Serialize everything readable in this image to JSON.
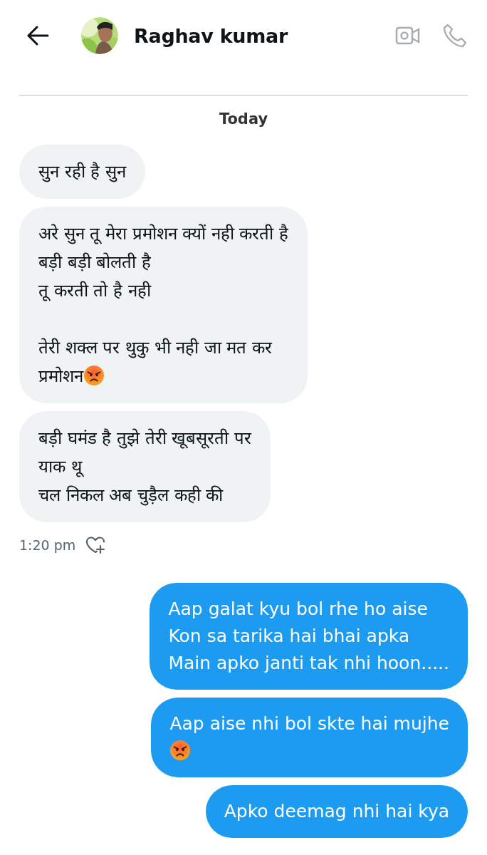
{
  "header": {
    "name": "Raghav kumar"
  },
  "date_divider": "Today",
  "messages": [
    {
      "kind": "received",
      "text": "सुन रही है सुन",
      "angry_emoji": false
    },
    {
      "kind": "received",
      "text": "अरे सुन तू मेरा प्रमोशन क्यों नही करती है\nबड़ी बड़ी बोलती है\nतू करती तो है नही\n\nतेरी शक्ल पर थुकु भी नही जा मत कर\nप्रमोशन",
      "angry_emoji": true
    },
    {
      "kind": "received",
      "text": "बड़ी घमंड है तुझे तेरी खूबसूरती पर\nयाक थू\nचल निकल अब चुड़ैल कही की",
      "angry_emoji": false,
      "time": "1:20 pm"
    },
    {
      "kind": "sent",
      "text": "Aap galat kyu bol rhe ho aise\nKon sa tarika hai bhai apka\nMain apko janti tak nhi hoon.....",
      "angry_emoji": false
    },
    {
      "kind": "sent",
      "text": "Aap aise nhi bol skte hai mujhe\n",
      "angry_emoji": true
    },
    {
      "kind": "sent",
      "text": "Apko deemag nhi hai kya",
      "angry_emoji": false
    }
  ]
}
